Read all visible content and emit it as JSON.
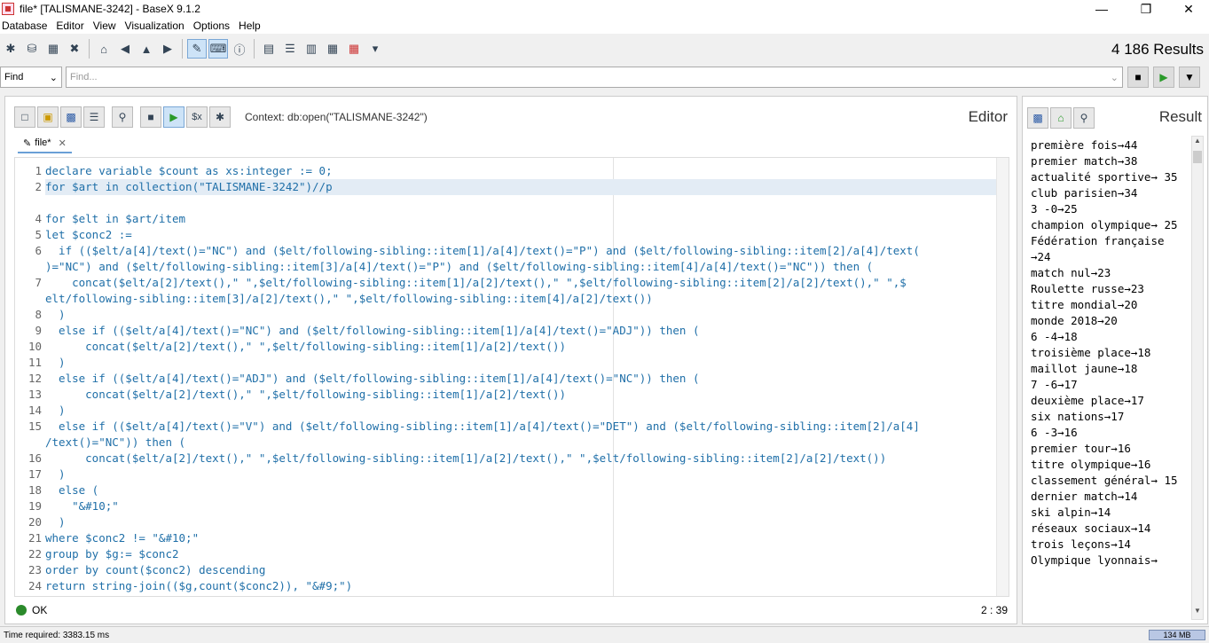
{
  "window": {
    "title": "file* [TALISMANE-3242] - BaseX 9.1.2"
  },
  "menu": [
    "Database",
    "Editor",
    "View",
    "Visualization",
    "Options",
    "Help"
  ],
  "results_count": "4 186 Results",
  "find": {
    "mode": "Find",
    "placeholder": "Find..."
  },
  "editor": {
    "title": "Editor",
    "context": "Context: db:open(\"TALISMANE-3242\")",
    "tab": "file*",
    "status": "OK",
    "cursor": "2 : 39",
    "lines": [
      "declare variable $count as xs:integer := 0;",
      "for $art in collection(\"TALISMANE-3242\")//p",
      "",
      "for $elt in $art/item",
      "let $conc2 :=",
      "  if (($elt/a[4]/text()=\"NC\") and ($elt/following-sibling::item[1]/a[4]/text()=\"P\") and ($elt/following-sibling::item[2]/a[4]/text(",
      ")=\"NC\") and ($elt/following-sibling::item[3]/a[4]/text()=\"P\") and ($elt/following-sibling::item[4]/a[4]/text()=\"NC\")) then (",
      "    concat($elt/a[2]/text(),\" \",$elt/following-sibling::item[1]/a[2]/text(),\" \",$elt/following-sibling::item[2]/a[2]/text(),\" \",$",
      "elt/following-sibling::item[3]/a[2]/text(),\" \",$elt/following-sibling::item[4]/a[2]/text())",
      "  )",
      "  else if (($elt/a[4]/text()=\"NC\") and ($elt/following-sibling::item[1]/a[4]/text()=\"ADJ\")) then (",
      "      concat($elt/a[2]/text(),\" \",$elt/following-sibling::item[1]/a[2]/text())",
      "  )",
      "  else if (($elt/a[4]/text()=\"ADJ\") and ($elt/following-sibling::item[1]/a[4]/text()=\"NC\")) then (",
      "      concat($elt/a[2]/text(),\" \",$elt/following-sibling::item[1]/a[2]/text())",
      "  )",
      "  else if (($elt/a[4]/text()=\"V\") and ($elt/following-sibling::item[1]/a[4]/text()=\"DET\") and ($elt/following-sibling::item[2]/a[4]",
      "/text()=\"NC\")) then (",
      "      concat($elt/a[2]/text(),\" \",$elt/following-sibling::item[1]/a[2]/text(),\" \",$elt/following-sibling::item[2]/a[2]/text())",
      "  )",
      "  else (",
      "    \"&#10;\"",
      "  )",
      "where $conc2 != \"&#10;\"",
      "group by $g:= $conc2",
      "order by count($conc2) descending",
      "return string-join(($g,count($conc2)), \"&#9;\")"
    ],
    "line_numbers": [
      "1",
      "2",
      "",
      "4",
      "5",
      "6",
      "",
      "7",
      "",
      "8",
      "9",
      "10",
      "11",
      "12",
      "13",
      "14",
      "15",
      "",
      "16",
      "17",
      "18",
      "19",
      "20",
      "21",
      "22",
      "23",
      "24"
    ]
  },
  "result": {
    "title": "Result",
    "items": [
      "première fois→44",
      "premier match→38",
      "actualité sportive→ 35",
      "club parisien→34",
      "3 -0→25",
      "champion olympique→ 25",
      "Fédération française →24",
      "match nul→23",
      "Roulette russe→23",
      "titre mondial→20",
      "monde 2018→20",
      "6 -4→18",
      "troisième place→18",
      "maillot jaune→18",
      "7 -6→17",
      "deuxième place→17",
      "six nations→17",
      "6 -3→16",
      "premier tour→16",
      "titre olympique→16",
      "classement général→ 15",
      "dernier match→14",
      "ski alpin→14",
      "réseaux sociaux→14",
      "trois leçons→14",
      "Olympique lyonnais→"
    ]
  },
  "status": {
    "time": "Time required: 3383.15 ms",
    "memory": "134 MB"
  }
}
